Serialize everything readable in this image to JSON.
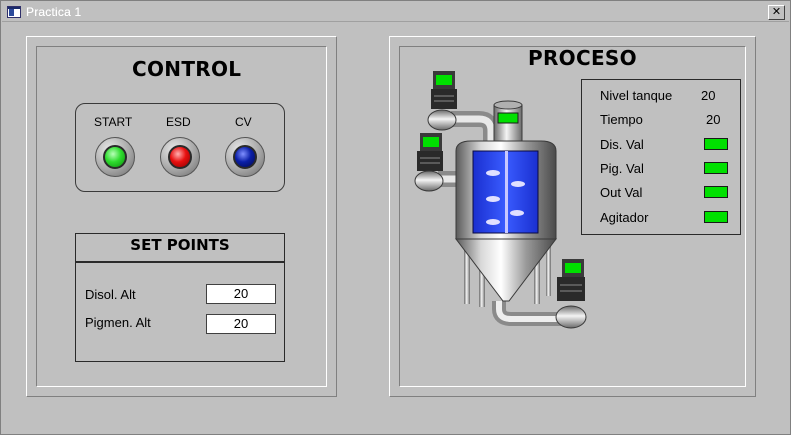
{
  "window": {
    "title": "Practica 1",
    "close_glyph": "✕"
  },
  "control": {
    "title": "CONTROL",
    "buttons": [
      {
        "label": "START",
        "color": "#2edc2e"
      },
      {
        "label": "ESD",
        "color": "#e80f0f"
      },
      {
        "label": "CV",
        "color": "#0b1fa8"
      }
    ]
  },
  "set_points": {
    "title": "SET POINTS",
    "fields": [
      {
        "label": "Disol. Alt",
        "value": "20"
      },
      {
        "label": "Pigmen. Alt",
        "value": "20"
      }
    ]
  },
  "proceso": {
    "title": "PROCESO",
    "status": {
      "nivel_label": "Nivel tanque",
      "nivel_value": "20",
      "tiempo_label": "Tiempo",
      "tiempo_value": "20",
      "leds": [
        {
          "label": "Dis. Val",
          "color": "#00e000"
        },
        {
          "label": "Pig. Val",
          "color": "#00e000"
        },
        {
          "label": "Out Val",
          "color": "#00e000"
        },
        {
          "label": "Agitador",
          "color": "#00e000"
        }
      ]
    }
  }
}
